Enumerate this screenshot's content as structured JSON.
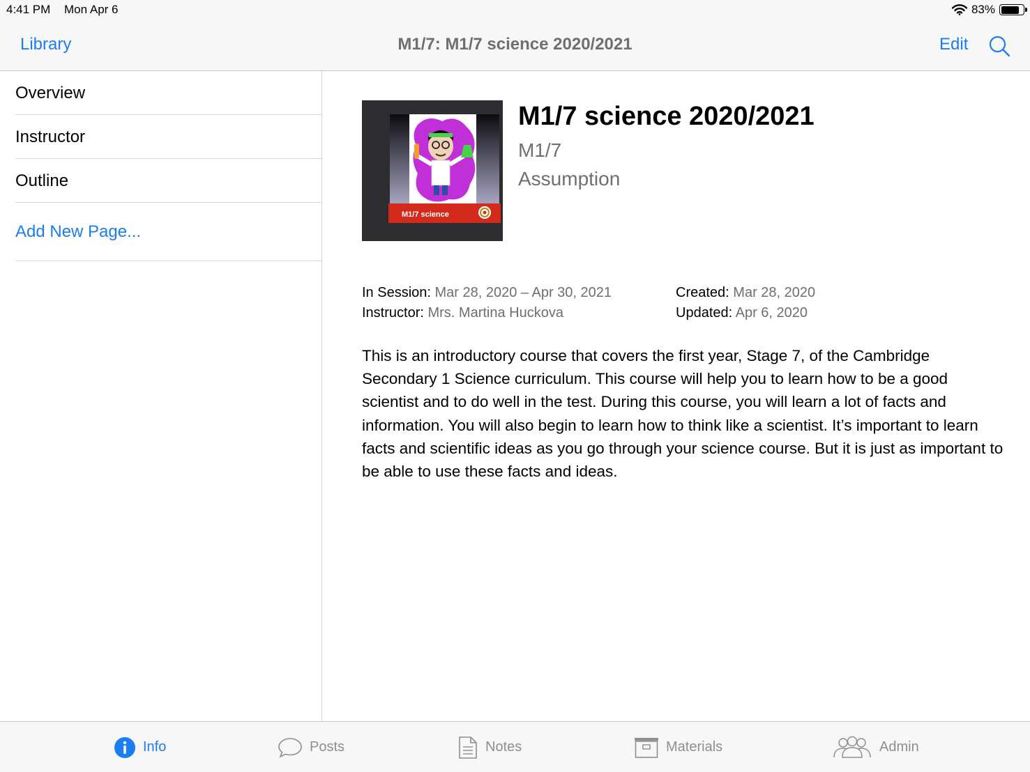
{
  "status_bar": {
    "time": "4:41 PM",
    "date": "Mon Apr 6",
    "battery": "83%",
    "wifi_icon": "wifi-icon",
    "battery_icon": "battery-icon"
  },
  "nav": {
    "back_label": "Library",
    "title": "M1/7: M1/7 science 2020/2021",
    "edit_label": "Edit",
    "search_icon": "search-icon"
  },
  "sidebar": {
    "items": [
      {
        "label": "Overview"
      },
      {
        "label": "Instructor"
      },
      {
        "label": "Outline"
      }
    ],
    "add_label": "Add New Page..."
  },
  "course": {
    "cover_caption": "M1/7 science",
    "title": "M1/7 science 2020/2021",
    "code": "M1/7",
    "school": "Assumption",
    "session_label": "In Session:",
    "session_value": "Mar 28, 2020 – Apr 30, 2021",
    "instructor_label": "Instructor:",
    "instructor_value": "Mrs. Martina Huckova",
    "created_label": "Created:",
    "created_value": "Mar 28, 2020",
    "updated_label": "Updated:",
    "updated_value": "Apr 6, 2020",
    "description": "This is an introductory course that covers the first year, Stage 7, of the Cambridge Secondary 1 Science curriculum. This course will help you to learn how to be a good scientist and to do well in the test. During this course, you will learn a lot of facts and information. You will also begin to learn how to think like a scientist. It’s important to learn facts and scientific ideas as you go through your science course. But it is just as important to be able to use these facts and ideas."
  },
  "tabs": [
    {
      "label": "Info",
      "icon": "info-icon",
      "active": true
    },
    {
      "label": "Posts",
      "icon": "speech-bubble-icon",
      "active": false
    },
    {
      "label": "Notes",
      "icon": "document-icon",
      "active": false
    },
    {
      "label": "Materials",
      "icon": "archive-box-icon",
      "active": false
    },
    {
      "label": "Admin",
      "icon": "people-icon",
      "active": false
    }
  ],
  "colors": {
    "accent": "#1a7ef2",
    "secondary_text": "#6e6e73",
    "tab_inactive": "#8e8e93",
    "bar_background": "#f7f7f7",
    "cover_banner": "#d42a1c",
    "cover_blob": "#c12fd9"
  }
}
